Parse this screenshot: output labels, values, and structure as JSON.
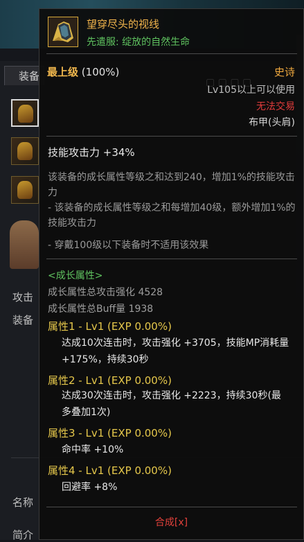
{
  "background": {
    "tab_label": "装备",
    "labels": [
      "攻击",
      "装备",
      "名称",
      "简介"
    ]
  },
  "tooltip": {
    "icon": "gauntlet-icon",
    "item_name": "望穿尽头的视线",
    "set_name": "先遣服: 绽放的自然生命",
    "grade_label": "最上级",
    "grade_value": "(100%)",
    "rarity": "史诗",
    "level_req": "Lv105以上可以使用",
    "trade": "无法交易",
    "equip_type": "布甲(头肩)",
    "skill_attack": "技能攻击力  +34%",
    "desc_main": "该装备的成长属性等级之和达到240，增加1%的技能攻击力",
    "desc_note1": "- 该装备的成长属性等级之和每增加40级，额外增加1%的技能攻击力",
    "desc_note2": "- 穿戴100级以下装备时不适用该效果",
    "growth_header": "<成长属性>",
    "growth_attack": "成长属性总攻击强化 4528",
    "growth_buff": "成长属性总Buff量 1938",
    "attributes": [
      {
        "title": "属性1 - Lv1 (EXP 0.00%)",
        "effect": "达成10次连击时，攻击强化 +3705，技能MP消耗量 +175%，持续30秒"
      },
      {
        "title": "属性2 - Lv1 (EXP 0.00%)",
        "effect": "达成30次连击时，攻击强化 +2223，持续30秒(最多叠加1次)"
      },
      {
        "title": "属性3 - Lv1 (EXP 0.00%)",
        "effect": "命中率 +10%"
      },
      {
        "title": "属性4 - Lv1 (EXP 0.00%)",
        "effect": "回避率 +8%"
      }
    ],
    "synthesize": "合成[x]"
  },
  "colors": {
    "item_name": "#f0b34b",
    "set_name": "#5fc25f",
    "rarity": "#f0a93f",
    "untradeable": "#e23b3b",
    "attribute_title": "#e6c84b"
  }
}
